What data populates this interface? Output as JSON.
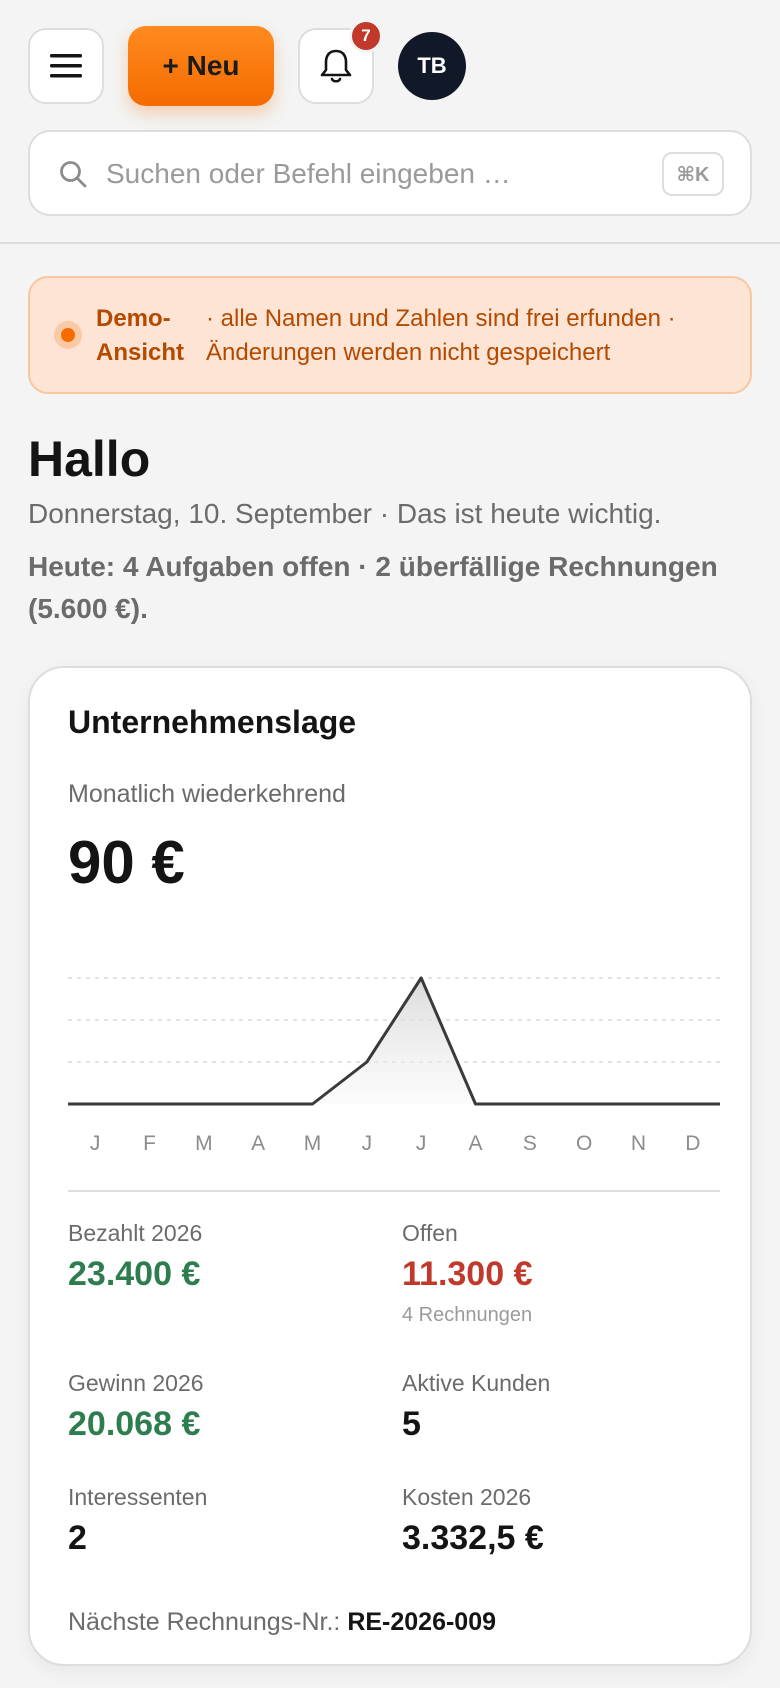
{
  "header": {
    "new_label": "+ Neu",
    "notification_count": "7",
    "avatar_initials": "TB",
    "search_placeholder": "Suchen oder Befehl eingeben …",
    "search_shortcut": "⌘K",
    "icons": [
      "menu-icon",
      "bell-icon",
      "search-icon"
    ]
  },
  "demo_banner": {
    "label": "Demo-Ansicht",
    "text": "· alle Namen und Zahlen sind frei erfunden · Änderungen werden nicht gespeichert"
  },
  "greeting": {
    "title": "Hallo",
    "date_line": "Donnerstag, 10. September · Das ist heute wichtig.",
    "summary": "Heute: 4 Aufgaben offen · 2 überfällige Rechnungen (5.600 €)."
  },
  "card": {
    "title": "Unternehmenslage",
    "mrr_label": "Monatlich wiederkehrend",
    "mrr_value": "90 €",
    "stats": {
      "paid_label": "Bezahlt 2026",
      "paid_value": "23.400 €",
      "open_label": "Offen",
      "open_value": "11.300 €",
      "open_sub": "4 Rechnungen",
      "profit_label": "Gewinn 2026",
      "profit_value": "20.068 €",
      "customers_label": "Aktive Kunden",
      "customers_value": "5",
      "leads_label": "Interessenten",
      "leads_value": "2",
      "costs_label": "Kosten 2026",
      "costs_value": "3.332,5 €"
    },
    "next_invoice_label": "Nächste Rechnungs-Nr.:",
    "next_invoice_value": "RE-2026-009"
  },
  "colors": {
    "accent": "#f46b00",
    "positive": "#2e7d4f",
    "negative": "#c0392b",
    "banner_bg": "#fde4d4"
  },
  "chart_data": {
    "type": "area",
    "categories": [
      "J",
      "F",
      "M",
      "A",
      "M",
      "J",
      "J",
      "A",
      "S",
      "O",
      "N",
      "D"
    ],
    "values": [
      0,
      0,
      0,
      0,
      0,
      30,
      90,
      0,
      0,
      0,
      0,
      0
    ],
    "ylim": [
      0,
      90
    ],
    "grid": true,
    "title": "",
    "xlabel": "",
    "ylabel": ""
  }
}
